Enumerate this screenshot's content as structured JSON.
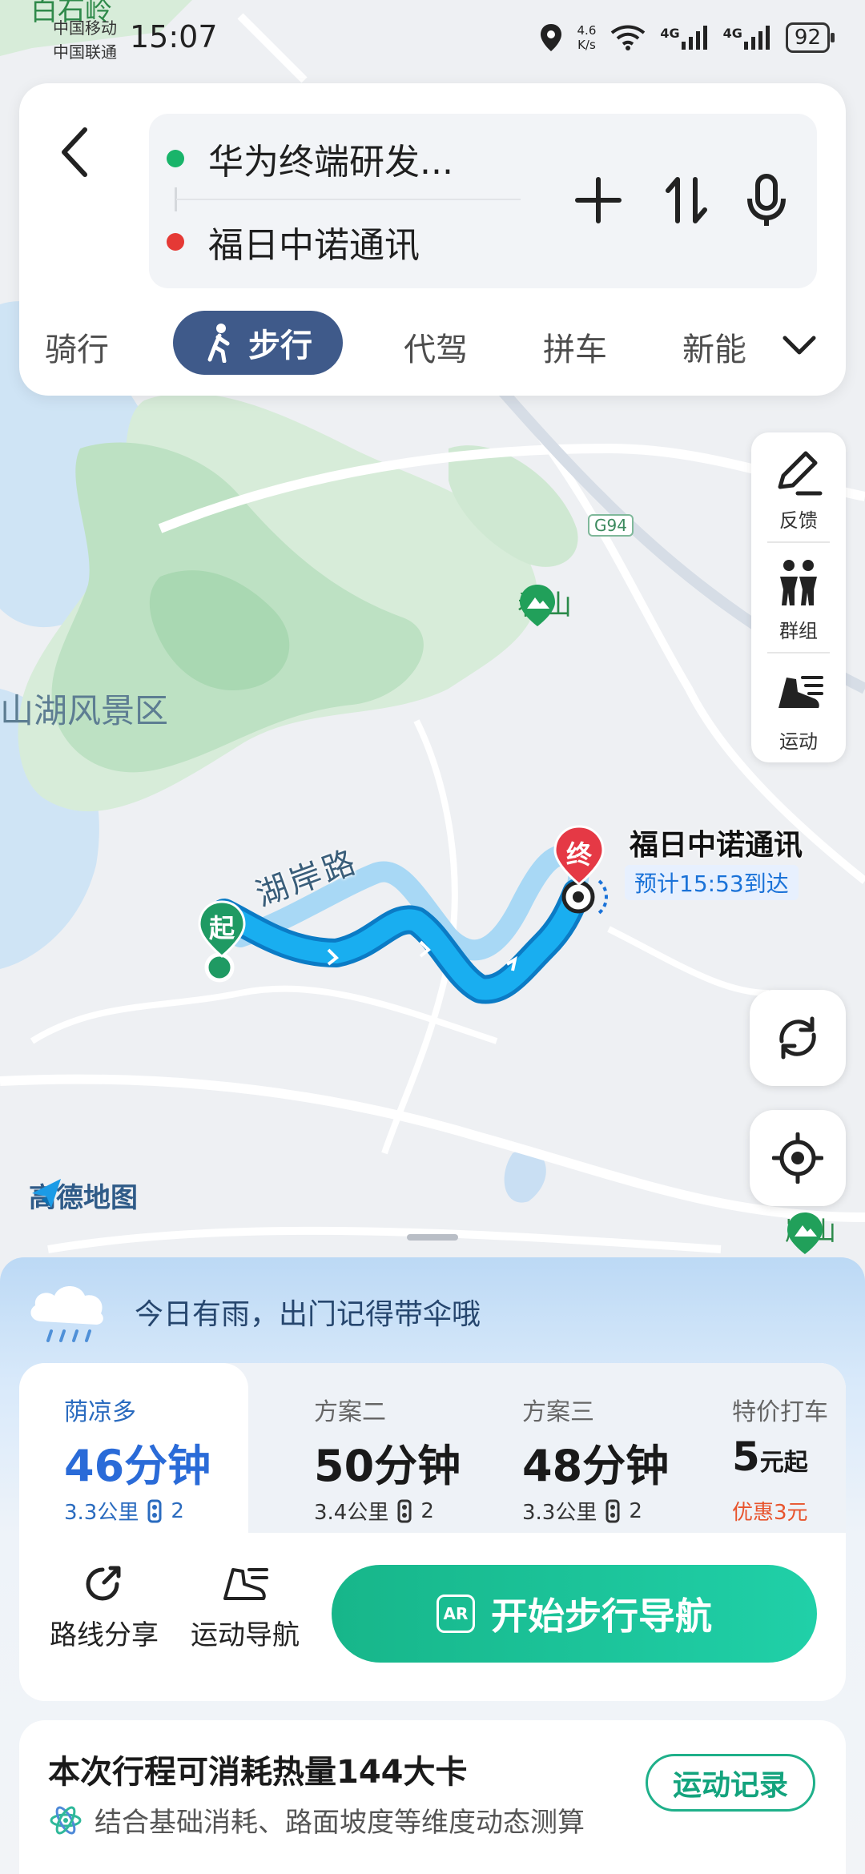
{
  "status_bar": {
    "carrier_1": "中国移动",
    "carrier_2": "中国联通",
    "time": "15:07",
    "speed_value": "4.6",
    "speed_unit": "K/s",
    "net_1": "4G",
    "net_2": "4G",
    "battery": "92"
  },
  "route": {
    "from": "华为终端研发...",
    "to": "福日中诺通讯"
  },
  "modes": {
    "items": [
      "骑行",
      "步行",
      "代驾",
      "拼车",
      "新能"
    ],
    "active": "步行"
  },
  "map": {
    "labels": {
      "top_place": "白石岭",
      "scenic": "山湖风景区",
      "mountain": "看山",
      "highway": "G94",
      "road": "湖岸路",
      "bottom_right": "崩山"
    },
    "start_marker": "起",
    "end_marker": "终",
    "destination_name": "福日中诺通讯",
    "eta": "预计15:53到达",
    "brand": "高德地图"
  },
  "tools": {
    "feedback": "反馈",
    "group": "群组",
    "sport": "运动"
  },
  "sheet": {
    "weather_tip": "今日有雨，出门记得带伞哦",
    "plans": [
      {
        "name": "荫凉多",
        "time": "46分钟",
        "distance": "3.3公里",
        "lights": "2"
      },
      {
        "name": "方案二",
        "time": "50分钟",
        "distance": "3.4公里",
        "lights": "2"
      },
      {
        "name": "方案三",
        "time": "48分钟",
        "distance": "3.3公里",
        "lights": "2"
      }
    ],
    "taxi": {
      "name": "特价打车",
      "price": "5",
      "unit": "元起",
      "discount": "优惠3元"
    },
    "share_label": "路线分享",
    "sport_nav_label": "运动导航",
    "start_label": "开始步行导航",
    "ar_label": "AR",
    "calorie_title": "本次行程可消耗热量144大卡",
    "calorie_sub": "结合基础消耗、路面坡度等维度动态测算",
    "record_label": "运动记录"
  },
  "colors": {
    "route_blue": "#12a3e8",
    "accent_green": "#17b68a",
    "active_mode": "#3f5a8a",
    "start_marker": "#1f9a63",
    "end_marker": "#e53945"
  }
}
